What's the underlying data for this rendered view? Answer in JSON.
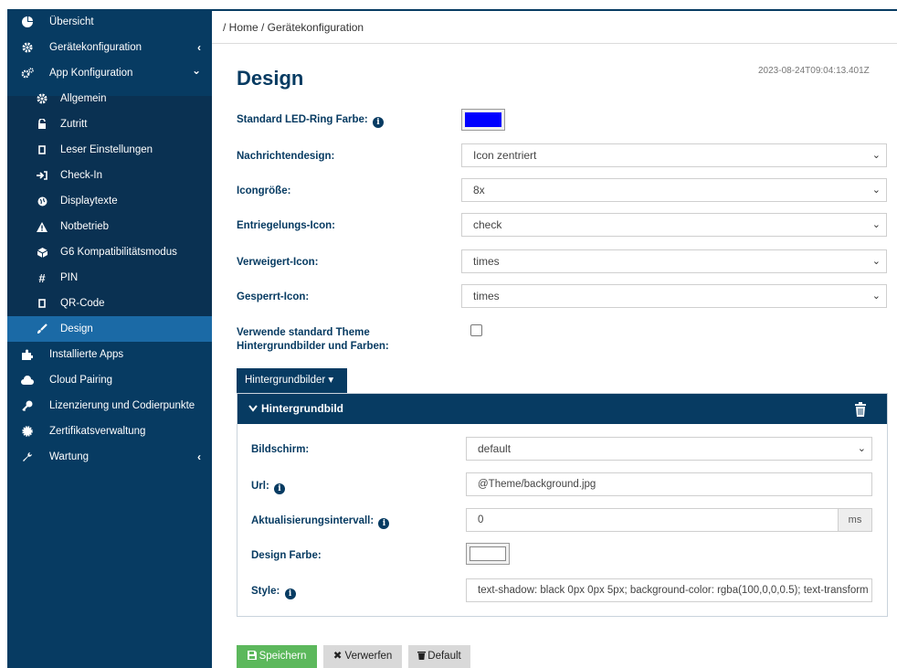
{
  "sidebar": {
    "items": [
      {
        "label": "Übersicht",
        "icon": "pie-chart-icon"
      },
      {
        "label": "Gerätekonfiguration",
        "icon": "gear-icon",
        "chevron": "‹"
      },
      {
        "label": "App Konfiguration",
        "icon": "gears-icon",
        "chevron": "⌄"
      },
      {
        "label": "Allgemein",
        "icon": "gear-icon"
      },
      {
        "label": "Zutritt",
        "icon": "unlock-icon"
      },
      {
        "label": "Leser Einstellungen",
        "icon": "mobile-icon"
      },
      {
        "label": "Check-In",
        "icon": "sign-in-icon"
      },
      {
        "label": "Displaytexte",
        "icon": "globe-icon"
      },
      {
        "label": "Notbetrieb",
        "icon": "warning-icon"
      },
      {
        "label": "G6 Kompatibilitätsmodus",
        "icon": "cube-icon"
      },
      {
        "label": "PIN",
        "icon": "hashtag-icon"
      },
      {
        "label": "QR-Code",
        "icon": "mobile-icon"
      },
      {
        "label": "Design",
        "icon": "paint-brush-icon"
      },
      {
        "label": "Installierte Apps",
        "icon": "puzzle-icon"
      },
      {
        "label": "Cloud Pairing",
        "icon": "cloud-icon"
      },
      {
        "label": "Lizenzierung und Codierpunkte",
        "icon": "key-icon"
      },
      {
        "label": "Zertifikatsverwaltung",
        "icon": "certificate-icon"
      },
      {
        "label": "Wartung",
        "icon": "wrench-icon",
        "chevron": "‹"
      }
    ]
  },
  "breadcrumb": "/ Home / Gerätekonfiguration",
  "page": {
    "title": "Design",
    "timestamp": "2023-08-24T09:04:13.401Z"
  },
  "form": {
    "led_label": "Standard LED-Ring Farbe:",
    "led_color": "#0000ff",
    "message_design_label": "Nachrichtendesign:",
    "message_design_value": "Icon zentriert",
    "icon_size_label": "Icongröße:",
    "icon_size_value": "8x",
    "unlock_icon_label": "Entriegelungs-Icon:",
    "unlock_icon_value": "check",
    "denied_icon_label": "Verweigert-Icon:",
    "denied_icon_value": "times",
    "locked_icon_label": "Gesperrt-Icon:",
    "locked_icon_value": "times",
    "use_theme_label_line1": "Verwende standard Theme",
    "use_theme_label_line2": "Hintergrundbilder und Farben:",
    "use_theme_checked": false
  },
  "backgrounds": {
    "dropdown_label": "Hintergrundbilder ▾",
    "panel_title": "Hintergrundbild",
    "screen_label": "Bildschirm:",
    "screen_value": "default",
    "url_label": "Url:",
    "url_value": "@Theme/background.jpg",
    "interval_label": "Aktualisierungsintervall:",
    "interval_value": "0",
    "interval_unit": "ms",
    "design_color_label": "Design Farbe:",
    "design_color": "#ffffff",
    "style_label": "Style:",
    "style_value": "text-shadow: black 0px 0px 5px; background-color: rgba(100,0,0,0.5); text-transform"
  },
  "buttons": {
    "save": "Speichern",
    "discard": "Verwerfen",
    "default": "Default"
  },
  "colors": {
    "navy": "#073b62",
    "active": "#1b6aa6",
    "save_green": "#5cb85c"
  }
}
